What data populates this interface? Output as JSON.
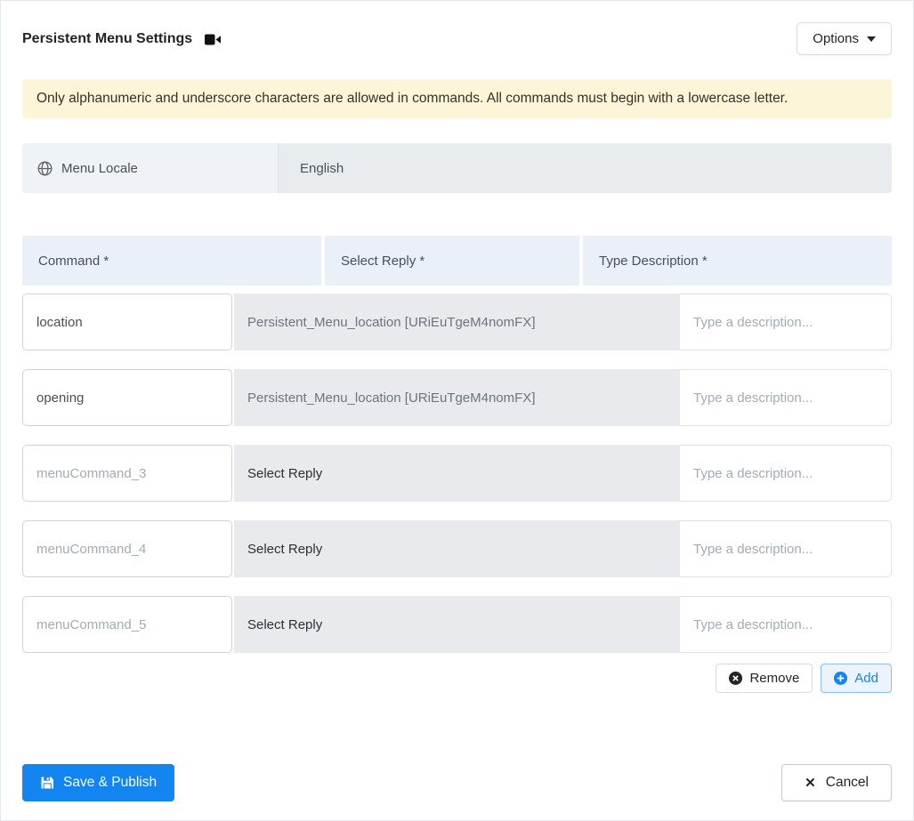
{
  "header": {
    "title": "Persistent Menu Settings",
    "options_button": "Options"
  },
  "alert": {
    "text": "Only alphanumeric and underscore characters are allowed in commands. All commands must begin with a lowercase letter."
  },
  "locale": {
    "label": "Menu Locale",
    "value": "English"
  },
  "table": {
    "headers": {
      "command": "Command *",
      "reply": "Select Reply *",
      "description": "Type Description *"
    },
    "rows": [
      {
        "command_value": "location",
        "command_placeholder": "",
        "reply_text": "Persistent_Menu_location [URiEuTgeM4nomFX]",
        "reply_state": "selected",
        "description_placeholder": "Type a description..."
      },
      {
        "command_value": "opening",
        "command_placeholder": "",
        "reply_text": "Persistent_Menu_location [URiEuTgeM4nomFX]",
        "reply_state": "selected",
        "description_placeholder": "Type a description..."
      },
      {
        "command_value": "",
        "command_placeholder": "menuCommand_3",
        "reply_text": "Select Reply",
        "reply_state": "empty",
        "description_placeholder": "Type a description..."
      },
      {
        "command_value": "",
        "command_placeholder": "menuCommand_4",
        "reply_text": "Select Reply",
        "reply_state": "empty",
        "description_placeholder": "Type a description..."
      },
      {
        "command_value": "",
        "command_placeholder": "menuCommand_5",
        "reply_text": "Select Reply",
        "reply_state": "empty",
        "description_placeholder": "Type a description..."
      }
    ]
  },
  "row_actions": {
    "remove_label": "Remove",
    "add_label": "Add"
  },
  "footer": {
    "save_label": "Save & Publish",
    "cancel_label": "Cancel"
  },
  "colors": {
    "accent_blue": "#1285f0",
    "alert_bg": "#fdf5d8",
    "header_cell_bg": "#eaf0f8",
    "muted_bg": "#e9ecef"
  }
}
